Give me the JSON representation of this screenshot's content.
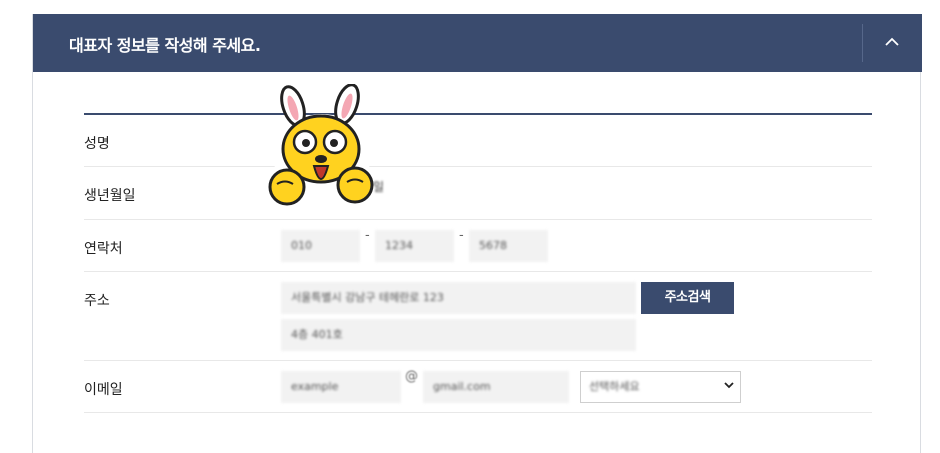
{
  "header": {
    "title": "대표자 정보를 작성해 주세요.",
    "collapse_icon": "chevron-up-icon"
  },
  "form": {
    "name": {
      "label": "성명"
    },
    "birth": {
      "label": "생년월일",
      "suffix": "일"
    },
    "phone": {
      "label": "연락처",
      "part1": "010",
      "separator1": "-",
      "part2": "1234",
      "separator2": "-",
      "part3": "5678"
    },
    "address": {
      "label": "주소",
      "line1": "서울특별시 강남구 테헤란로 123",
      "line2": "4층 401호",
      "search_button": "주소검색"
    },
    "email": {
      "label": "이메일",
      "local": "example",
      "at": "@",
      "domain": "gmail.com",
      "domain_select": "선택하세요"
    }
  },
  "sticker": {
    "icon": "rabbit-mascot-sticker"
  },
  "colors": {
    "header_bg": "#3a4b6e",
    "button_bg": "#3a4b6e",
    "field_bg": "#f2f2f2"
  }
}
